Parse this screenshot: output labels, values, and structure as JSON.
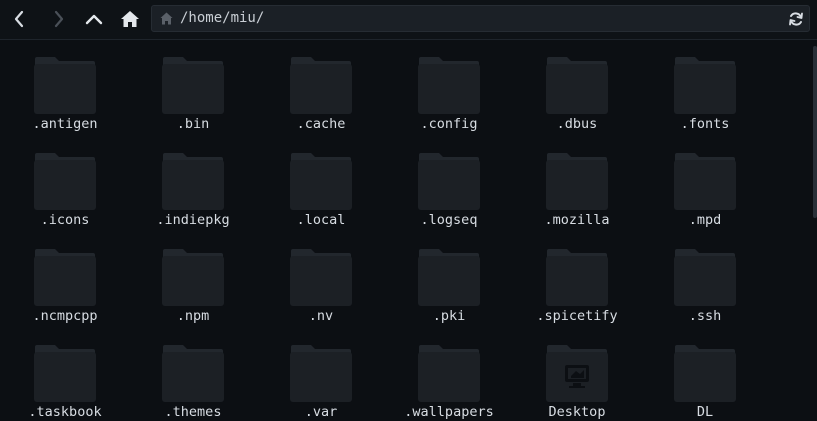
{
  "toolbar": {
    "back_icon": "chevron-left-icon",
    "forward_icon": "chevron-right-icon",
    "up_icon": "chevron-up-icon",
    "home_icon": "home-icon",
    "refresh_icon": "refresh-icon"
  },
  "location": {
    "path": "/home/miu/"
  },
  "colors": {
    "background": "#0c0f13",
    "folder": "#1c2025",
    "folder_tab": "#22272d",
    "text": "#d8dde3",
    "disabled_icon": "#4a5058"
  },
  "items": [
    {
      "label": ".antigen",
      "icon": "folder-icon"
    },
    {
      "label": ".bin",
      "icon": "folder-icon"
    },
    {
      "label": ".cache",
      "icon": "folder-icon"
    },
    {
      "label": ".config",
      "icon": "folder-icon"
    },
    {
      "label": ".dbus",
      "icon": "folder-icon"
    },
    {
      "label": ".fonts",
      "icon": "folder-icon"
    },
    {
      "label": ".icons",
      "icon": "folder-icon"
    },
    {
      "label": ".indiepkg",
      "icon": "folder-icon"
    },
    {
      "label": ".local",
      "icon": "folder-icon"
    },
    {
      "label": ".logseq",
      "icon": "folder-icon"
    },
    {
      "label": ".mozilla",
      "icon": "folder-icon"
    },
    {
      "label": ".mpd",
      "icon": "folder-icon"
    },
    {
      "label": ".ncmpcpp",
      "icon": "folder-icon"
    },
    {
      "label": ".npm",
      "icon": "folder-icon"
    },
    {
      "label": ".nv",
      "icon": "folder-icon"
    },
    {
      "label": ".pki",
      "icon": "folder-icon"
    },
    {
      "label": ".spicetify",
      "icon": "folder-icon"
    },
    {
      "label": ".ssh",
      "icon": "folder-icon"
    },
    {
      "label": ".taskbook",
      "icon": "folder-icon"
    },
    {
      "label": ".themes",
      "icon": "folder-icon"
    },
    {
      "label": ".var",
      "icon": "folder-icon"
    },
    {
      "label": ".wallpapers",
      "icon": "folder-icon"
    },
    {
      "label": "Desktop",
      "icon": "desktop-folder-icon"
    },
    {
      "label": "DL",
      "icon": "folder-icon"
    }
  ]
}
